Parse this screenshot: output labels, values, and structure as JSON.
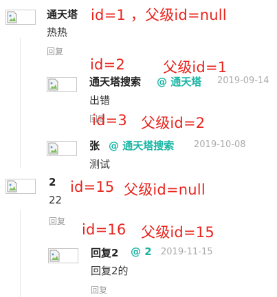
{
  "comments": [
    {
      "name": "通天塔",
      "mention": "",
      "date": "",
      "content": "热热",
      "reply": "回复"
    },
    {
      "name": "通天塔搜索",
      "mention": "@ 通天塔",
      "date": "2019-09-14",
      "content": "出错",
      "reply": "回复"
    },
    {
      "name": "张",
      "mention": "@ 通天塔搜索",
      "date": "2019-10-08",
      "content": "测试",
      "reply": ""
    },
    {
      "name": "2",
      "mention": "",
      "date": "",
      "content": "22",
      "reply": "回复"
    },
    {
      "name": "回复2",
      "mention": "@ 2",
      "date": "2019-11-15",
      "content": "回复2的",
      "reply": "回复"
    }
  ],
  "annotations": [
    "id=1 ，父级id=null",
    "id=2",
    "父级id=1",
    "id=3",
    "父级id=2",
    "id=15",
    "父级id=null",
    "id=16",
    "父级id=15"
  ],
  "colors": {
    "annotation": "#e8231c",
    "mention": "#19b5a3",
    "date": "#aaaaaa",
    "reply": "#999999"
  }
}
